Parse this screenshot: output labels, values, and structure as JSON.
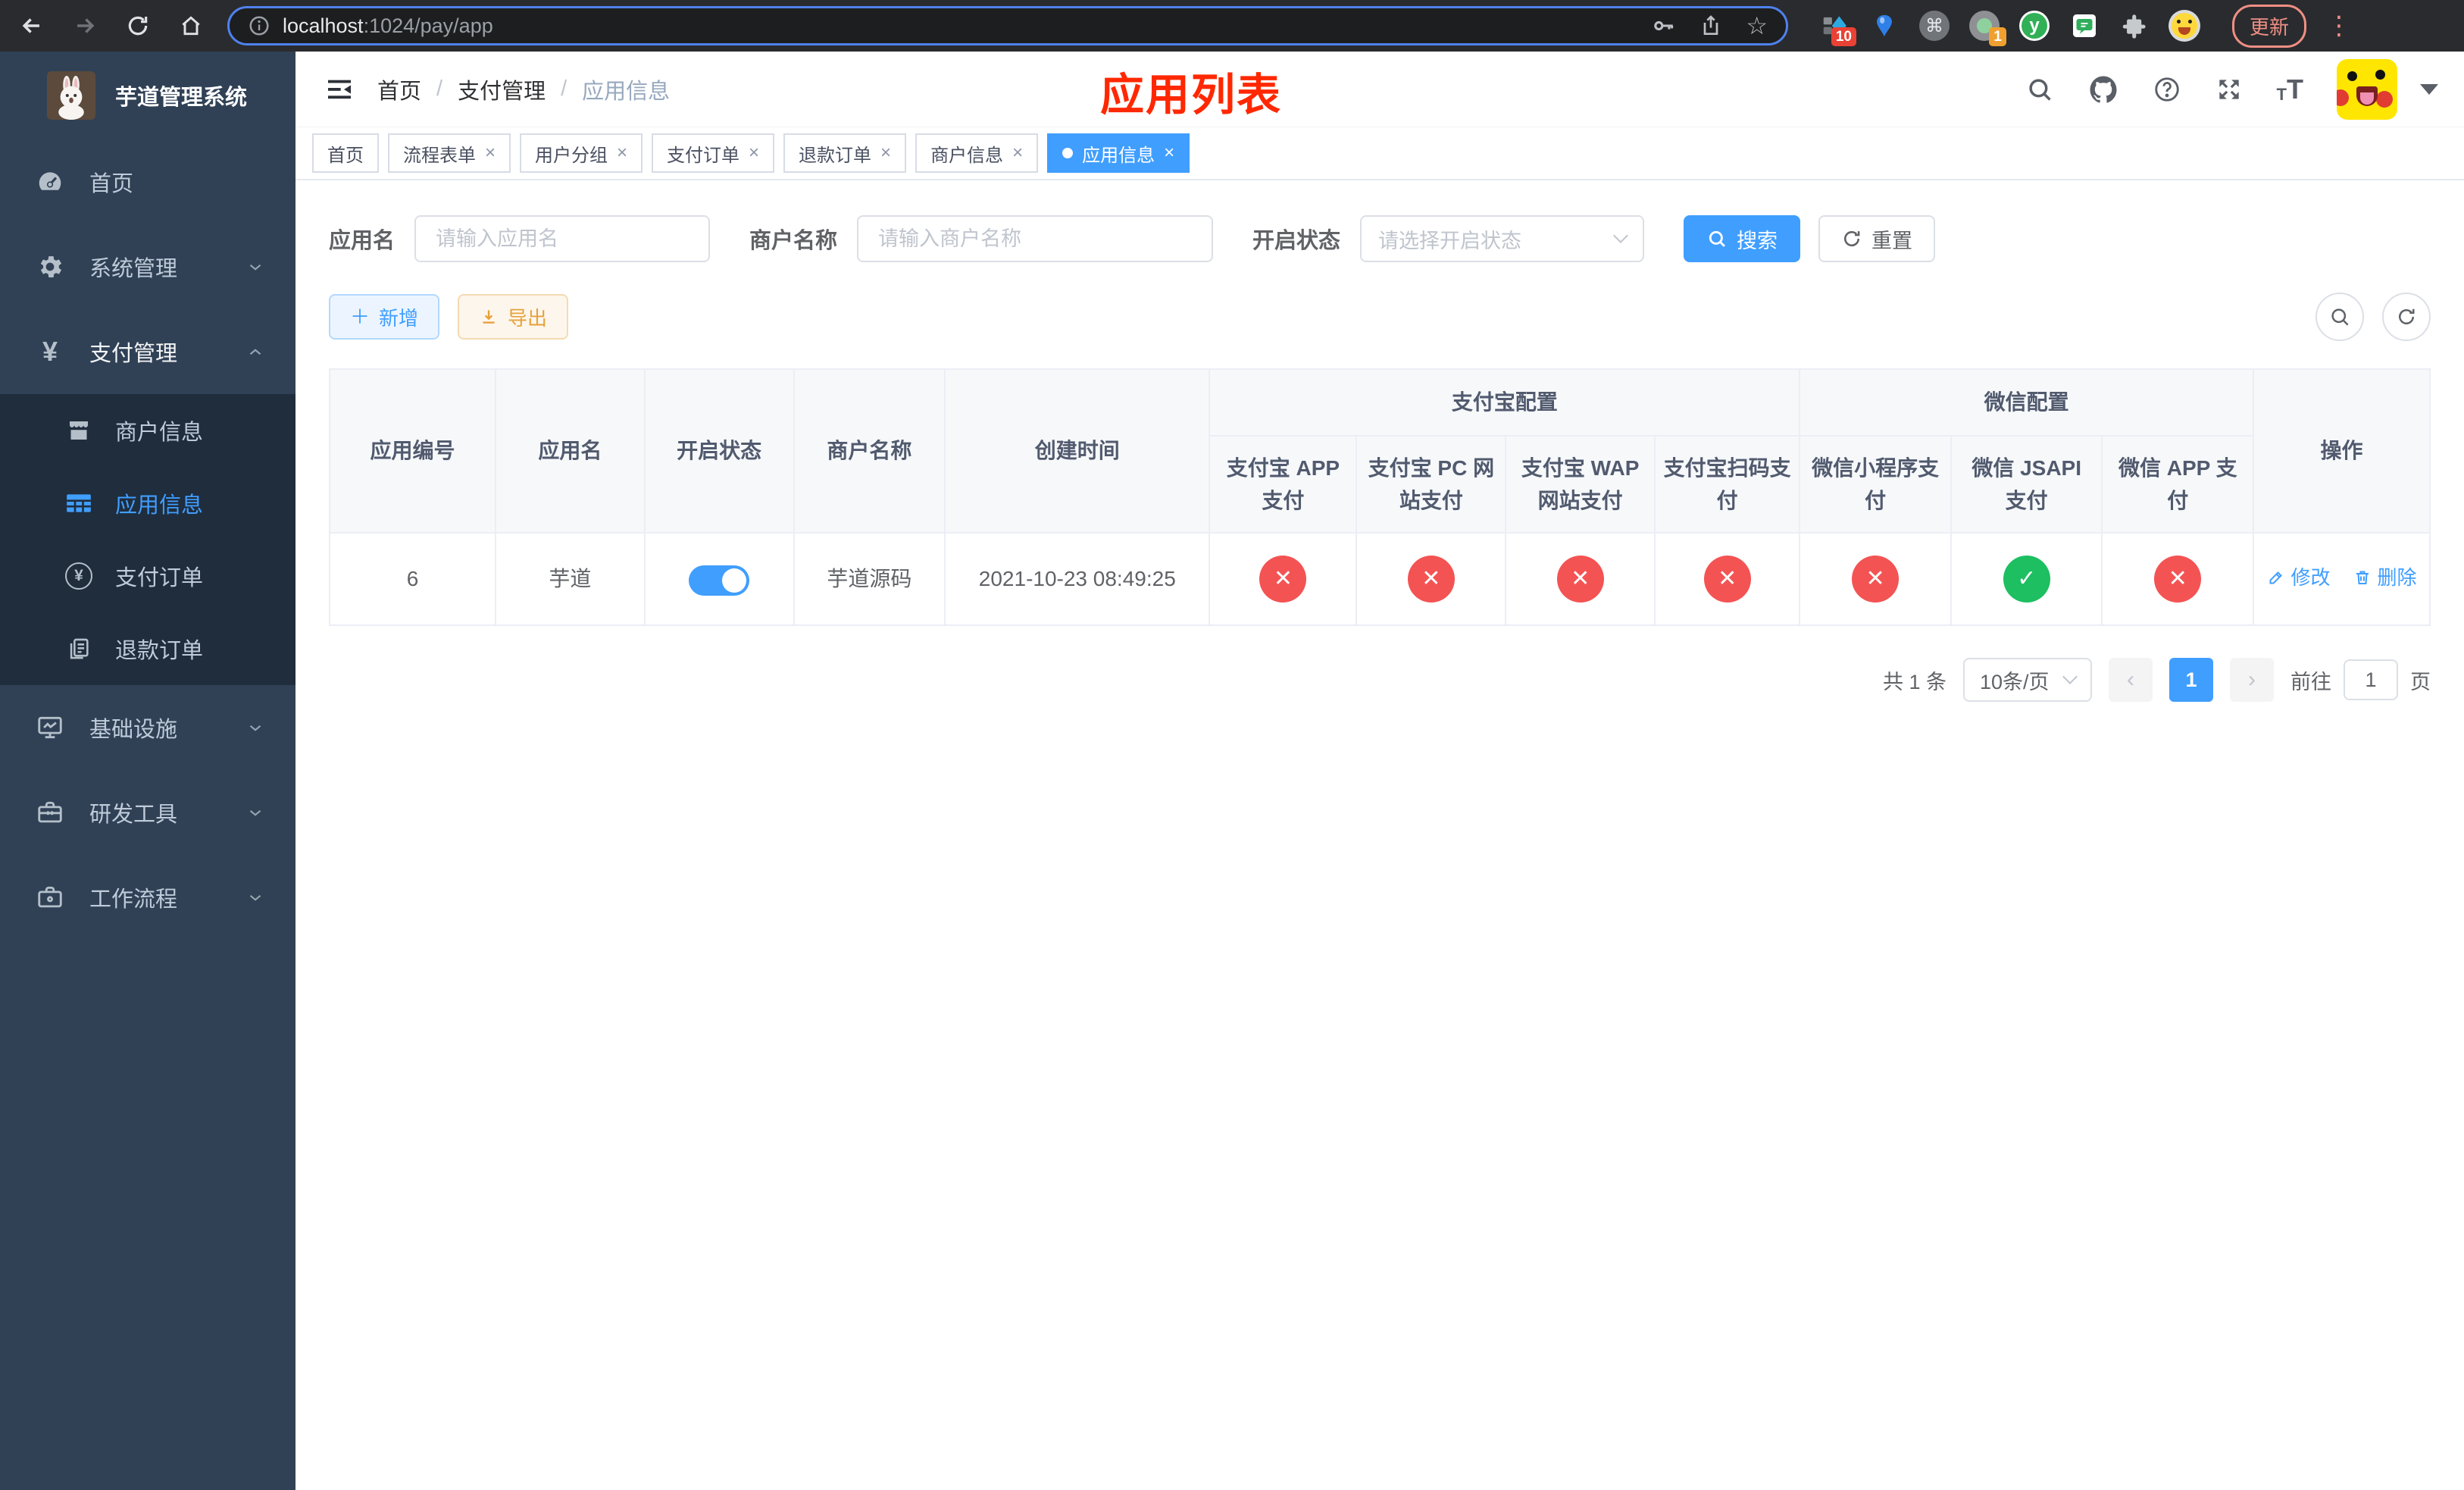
{
  "colors": {
    "primary": "#409eff",
    "success": "#1dbf61",
    "danger": "#f45353",
    "annotation": "#ff2800"
  },
  "browser": {
    "url": {
      "host": "localhost",
      "rest": ":1024/pay/app"
    },
    "star_icon": "☆",
    "extensions": {
      "diamond_badge": "10",
      "circle_badge": "1",
      "command_glyph": "⌘",
      "yuque_letter": "y"
    },
    "update_label": "更新",
    "menu_dots": "⋮"
  },
  "sidebar": {
    "title": "芋道管理系统",
    "yen": "¥",
    "menu": [
      {
        "label": "首页"
      },
      {
        "label": "系统管理"
      },
      {
        "label": "支付管理"
      },
      {
        "label": "商户信息"
      },
      {
        "label": "应用信息"
      },
      {
        "label": "支付订单"
      },
      {
        "label": "退款订单"
      },
      {
        "label": "基础设施"
      },
      {
        "label": "研发工具"
      },
      {
        "label": "工作流程"
      }
    ]
  },
  "navbar": {
    "breadcrumb": [
      "首页",
      "支付管理",
      "应用信息"
    ],
    "sep": "/"
  },
  "annotation": {
    "text": "应用列表"
  },
  "tabs": [
    {
      "label": "首页"
    },
    {
      "label": "流程表单"
    },
    {
      "label": "用户分组"
    },
    {
      "label": "支付订单"
    },
    {
      "label": "退款订单"
    },
    {
      "label": "商户信息"
    },
    {
      "label": "应用信息"
    }
  ],
  "icons": {
    "close": "×",
    "plus": "＋"
  },
  "filters": {
    "app_name_label": "应用名",
    "app_name_placeholder": "请输入应用名",
    "merchant_label": "商户名称",
    "merchant_placeholder": "请输入商户名称",
    "status_label": "开启状态",
    "status_placeholder": "请选择开启状态",
    "search_button": "搜索",
    "reset_button": "重置"
  },
  "toolbar": {
    "add_button": "新增",
    "export_button": "导出"
  },
  "table": {
    "headers": {
      "app_id": "应用编号",
      "app_name": "应用名",
      "status": "开启状态",
      "merchant": "商户名称",
      "created": "创建时间",
      "alipay_group": "支付宝配置",
      "alipay_cols": [
        "支付宝 APP 支付",
        "支付宝 PC 网站支付",
        "支付宝 WAP 网站支付",
        "支付宝扫码支付"
      ],
      "wechat_group": "微信配置",
      "wechat_cols": [
        "微信小程序支付",
        "微信 JSAPI 支付",
        "微信 APP 支付"
      ],
      "actions": "操作"
    },
    "rows": [
      {
        "app_id": "6",
        "app_name": "芋道",
        "enabled": true,
        "merchant": "芋道源码",
        "created": "2021-10-23 08:49:25",
        "statuses": [
          "no",
          "no",
          "no",
          "no",
          "no",
          "yes",
          "no"
        ],
        "edit_label": "修改",
        "delete_label": "删除"
      }
    ]
  },
  "pagination": {
    "total": "共 1 条",
    "page_size": "10条/页",
    "prev": "‹",
    "next": "›",
    "current_page": "1",
    "goto_label": "前往",
    "goto_value": "1",
    "goto_suffix": "页"
  }
}
